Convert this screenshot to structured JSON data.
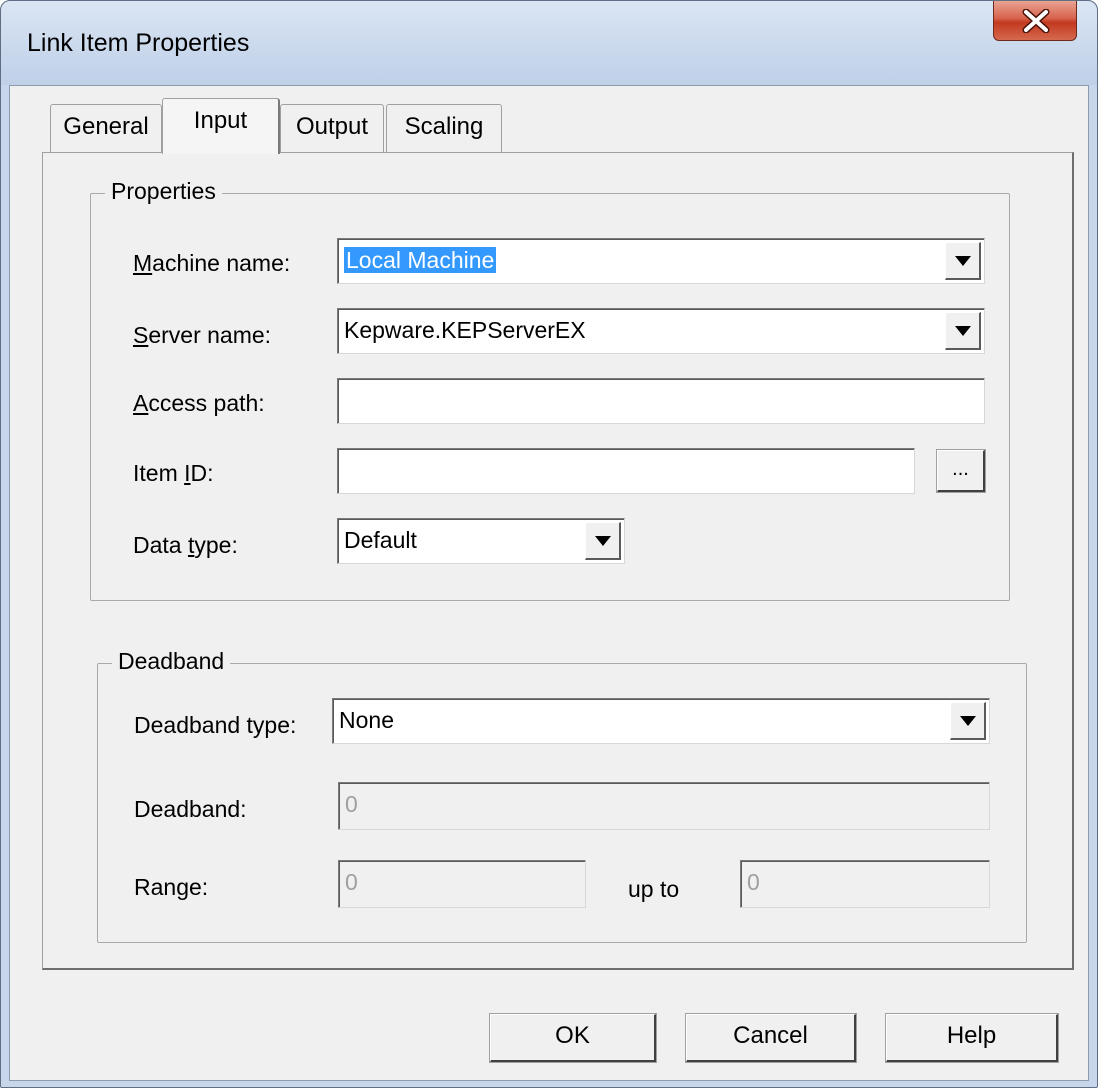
{
  "window": {
    "title": "Link Item Properties"
  },
  "tabs": [
    {
      "label": "General",
      "selected": false
    },
    {
      "label": "Input",
      "selected": true
    },
    {
      "label": "Output",
      "selected": false
    },
    {
      "label": "Scaling",
      "selected": false
    }
  ],
  "properties": {
    "group_title": "Properties",
    "machine_name": {
      "label_pre": "",
      "label_acc": "M",
      "label_post": "achine name:",
      "value": "Local Machine"
    },
    "server_name": {
      "label_pre": "",
      "label_acc": "S",
      "label_post": "erver name:",
      "value": "Kepware.KEPServerEX"
    },
    "access_path": {
      "label_pre": "",
      "label_acc": "A",
      "label_post": "ccess path:",
      "value": ""
    },
    "item_id": {
      "label_pre": "Item ",
      "label_acc": "I",
      "label_post": "D:",
      "value": "",
      "browse_label": "..."
    },
    "data_type": {
      "label_pre": "Data ",
      "label_acc": "t",
      "label_post": "ype:",
      "value": "Default"
    }
  },
  "deadband": {
    "group_title": "Deadband",
    "type_label": "Deadband type:",
    "type_value": "None",
    "deadband_label": "Deadband:",
    "deadband_value": "0",
    "range_label": "Range:",
    "range_from": "0",
    "range_sep": "up to",
    "range_to": "0"
  },
  "buttons": {
    "ok": "OK",
    "cancel": "Cancel",
    "help": "Help"
  },
  "colors": {
    "selection": "#3399ff",
    "close_button": "#c2391f"
  }
}
